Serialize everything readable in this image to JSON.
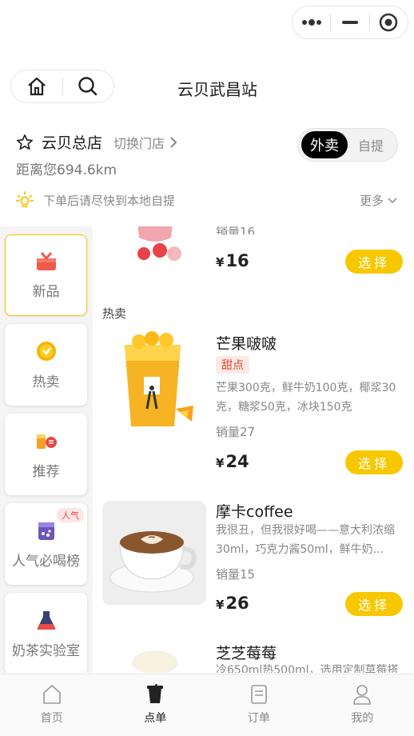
{
  "header": {
    "title": "云贝武昌站"
  },
  "store": {
    "name": "云贝总店",
    "switch_label": "切换门店",
    "distance": "距离您694.6km"
  },
  "mode": {
    "active": "外卖",
    "inactive": "自提"
  },
  "notice": {
    "text": "下单后请尽快到本地自提",
    "more_label": "更多"
  },
  "categories": [
    {
      "label": "新品",
      "icon": "gift-icon"
    },
    {
      "label": "热卖",
      "icon": "coin-icon"
    },
    {
      "label": "推荐",
      "icon": "drinks-icon"
    },
    {
      "label": "人气必喝榜",
      "icon": "cup-icon",
      "badge": "人气"
    },
    {
      "label": "奶茶实验室",
      "icon": "flask-icon"
    }
  ],
  "products": {
    "partial_top": {
      "price": "16",
      "sales": "销量16"
    },
    "section_hot": "热卖",
    "items": [
      {
        "name": "芒果啵啵",
        "tag": "甜点",
        "desc": "芒果300克，鲜牛奶100克，椰浆30克，糖浆50克，冰块150克",
        "sales": "销量27",
        "price": "24"
      },
      {
        "name": "摩卡coffee",
        "desc": "我很丑，但我很好喝——意大利浓缩30ml，巧克力酱50ml，鲜牛奶...",
        "sales": "销量15",
        "price": "26"
      },
      {
        "name": "芝芝莓莓",
        "desc": "冷650ml热500ml，选用定制草莓搭"
      }
    ],
    "currency": "¥",
    "select_label": "选择"
  },
  "tabbar": [
    {
      "label": "首页",
      "icon": "home-icon"
    },
    {
      "label": "点单",
      "icon": "order-cup-icon",
      "active": true
    },
    {
      "label": "订单",
      "icon": "receipt-icon"
    },
    {
      "label": "我的",
      "icon": "user-icon"
    }
  ],
  "colors": {
    "accent": "#f7c800",
    "tag_bg": "#fde9e6",
    "tag_text": "#e0452d"
  }
}
